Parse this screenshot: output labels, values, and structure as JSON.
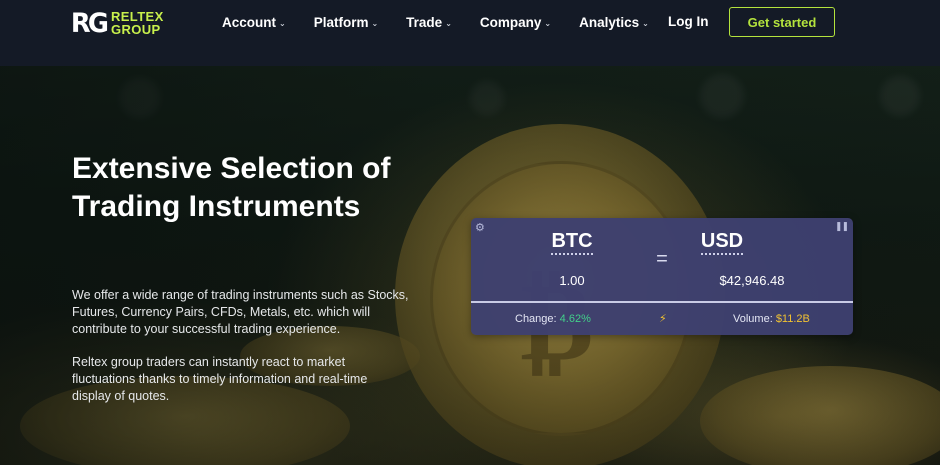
{
  "brand": {
    "mark": "RG",
    "name_line1": "RELTEX",
    "name_line2": "GROUP"
  },
  "nav": {
    "items": [
      {
        "label": "Account"
      },
      {
        "label": "Platform"
      },
      {
        "label": "Trade"
      },
      {
        "label": "Company"
      },
      {
        "label": "Analytics"
      }
    ],
    "login_label": "Log In",
    "cta_label": "Get started"
  },
  "hero": {
    "title": "Extensive Selection of Trading Instruments",
    "paragraph1": "We offer a wide range of trading instruments such as Stocks, Futures, Currency Pairs, CFDs, Metals, etc. which will contribute to your successful trading experience.",
    "paragraph2": "Reltex group traders can instantly react to market fluctuations thanks to timely information and real-time display of quotes."
  },
  "converter": {
    "from_symbol": "BTC",
    "to_symbol": "USD",
    "equals": "=",
    "from_amount": "1.00",
    "to_amount": "$42,946.48",
    "change_label": "Change:",
    "change_value": "4.62%",
    "volume_label": "Volume:",
    "volume_value": "$11.2B"
  },
  "icons": {
    "chevron": "chevron-down-icon",
    "gear": "gear-icon",
    "pause": "pause-icon",
    "bolt": "lightning-icon"
  },
  "colors": {
    "accent": "#b4e33d",
    "header_bg": "#141a26",
    "widget_bg": "#3e4070",
    "positive": "#42d08a",
    "volume": "#f1c232"
  }
}
